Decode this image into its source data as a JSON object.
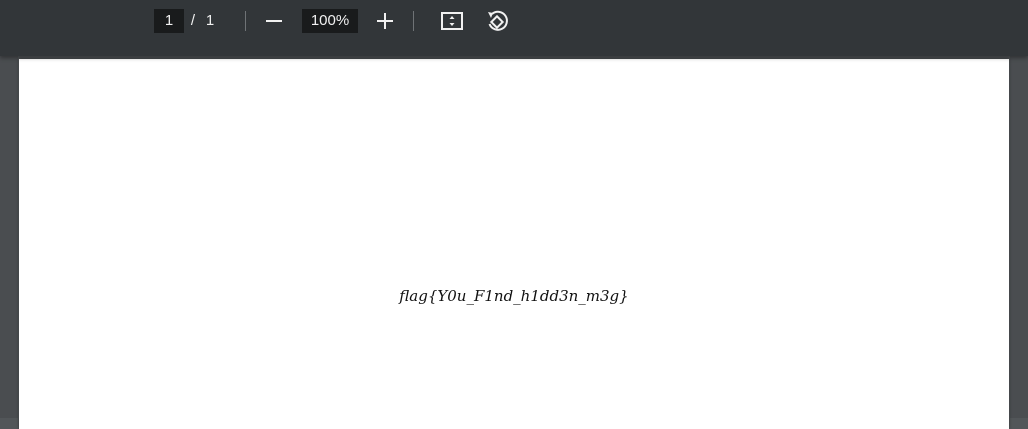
{
  "toolbar": {
    "current_page": "1",
    "page_separator": "/",
    "total_pages": "1",
    "zoom_level": "100%",
    "icons": {
      "zoom_out": "minus-icon",
      "zoom_in": "plus-icon",
      "fit": "fit-to-page-icon",
      "rotate": "rotate-icon"
    }
  },
  "document": {
    "content_text": "flag{Y0u_F1nd_h1dd3n_m3g}"
  },
  "colors": {
    "toolbar_bg": "#323639",
    "viewer_bg": "#525659",
    "field_bg": "#191b1c",
    "text_light": "#f1f1f1"
  }
}
